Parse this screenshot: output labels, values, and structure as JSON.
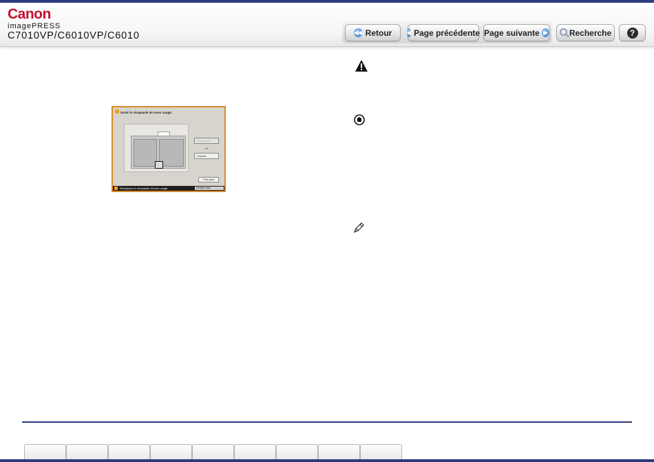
{
  "header": {
    "brand": "Canon",
    "subbrand": "imagePRESS",
    "model": "C7010VP/C6010VP/C6010"
  },
  "toolbar": {
    "back_label": "Retour",
    "prev_label": "Page précédente",
    "next_label": "Page suivante",
    "search_label": "Recherche",
    "help_label": "?"
  },
  "screen": {
    "title": "Sortir le réceptacle de toner usagé.",
    "prev_btn": "Précédent",
    "count": "1/4",
    "next_btn": "Suivant",
    "later_btn": "Plus tard",
    "status": "Remplacer le réceptacle d'encre usagé.",
    "monitor": "Moniteur état"
  },
  "icons": {
    "warning": "warning-icon",
    "important": "important-icon",
    "memo": "memo-pencil-icon"
  },
  "colors": {
    "brand_red": "#c4122f",
    "accent_navy": "#2e3a7e",
    "screen_border": "#d88a2a"
  },
  "footer_tabs": [
    "",
    "",
    "",
    "",
    "",
    "",
    "",
    "",
    ""
  ]
}
